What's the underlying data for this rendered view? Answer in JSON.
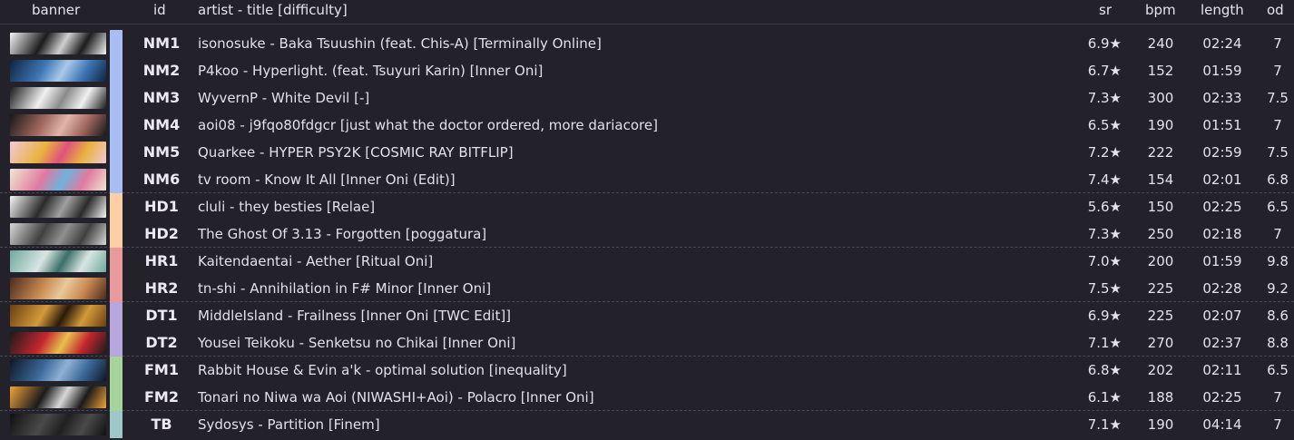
{
  "headers": {
    "banner": "banner",
    "id": "id",
    "title": "artist - title [difficulty]",
    "sr": "sr",
    "bpm": "bpm",
    "length": "length",
    "od": "od"
  },
  "mod_colors": {
    "NM": "#a7bdf4",
    "HD": "#f9cfa3",
    "HR": "#e89a9a",
    "DT": "#b7a6dc",
    "FM": "#a6d39a",
    "TB": "#9ec6c9"
  },
  "rows": [
    {
      "id": "NM1",
      "mod": "NM",
      "title": "isonosuke - Baka Tsuushin (feat. Chis-A) [Terminally Online]",
      "sr": "6.9★",
      "bpm": "240",
      "length": "02:24",
      "od": "7",
      "banner_colors": [
        "#f5f5f5",
        "#1c1c1c",
        "#cfcfcf"
      ]
    },
    {
      "id": "NM2",
      "mod": "NM",
      "title": "P4koo - Hyperlight. (feat. Tsuyuri Karin) [Inner Oni]",
      "sr": "6.7★",
      "bpm": "152",
      "length": "01:59",
      "od": "7",
      "banner_colors": [
        "#0e2440",
        "#3f77b5",
        "#a9c9ea"
      ]
    },
    {
      "id": "NM3",
      "mod": "NM",
      "title": "WyvernP - White Devil [-]",
      "sr": "7.3★",
      "bpm": "300",
      "length": "02:33",
      "od": "7.5",
      "banner_colors": [
        "#1a1a1a",
        "#f0f0f0",
        "#8a8a8a"
      ]
    },
    {
      "id": "NM4",
      "mod": "NM",
      "title": "aoi08 - j9fqo80fdgcr [just what the doctor ordered, more dariacore]",
      "sr": "6.5★",
      "bpm": "190",
      "length": "01:51",
      "od": "7",
      "banner_colors": [
        "#171717",
        "#a36a60",
        "#e1b5a8"
      ]
    },
    {
      "id": "NM5",
      "mod": "NM",
      "title": "Quarkee - HYPER PSY2K [COSMIC RAY BITFLIP]",
      "sr": "7.2★",
      "bpm": "222",
      "length": "02:59",
      "od": "7.5",
      "banner_colors": [
        "#f3c8d6",
        "#e9b23f",
        "#e0527c"
      ]
    },
    {
      "id": "NM6",
      "mod": "NM",
      "title": "tv room - Know It All [Inner Oni (Edit)]",
      "sr": "7.4★",
      "bpm": "154",
      "length": "02:01",
      "od": "6.8",
      "banner_colors": [
        "#f0e7d2",
        "#e07aa0",
        "#6fb2dc"
      ]
    },
    {
      "id": "HD1",
      "mod": "HD",
      "title": "cluli - they besties [Relae]",
      "sr": "5.6★",
      "bpm": "150",
      "length": "02:25",
      "od": "6.5",
      "banner_colors": [
        "#f6f6f6",
        "#2b2b2b",
        "#a0a0a0"
      ]
    },
    {
      "id": "HD2",
      "mod": "HD",
      "title": "The Ghost Of 3.13 - Forgotten [poggatura]",
      "sr": "7.3★",
      "bpm": "250",
      "length": "02:18",
      "od": "7",
      "banner_colors": [
        "#d8d8d8",
        "#404040",
        "#909090"
      ]
    },
    {
      "id": "HR1",
      "mod": "HR",
      "title": "Kaitendaentai - Aether [Ritual Oni]",
      "sr": "7.0★",
      "bpm": "200",
      "length": "01:59",
      "od": "9.8",
      "banner_colors": [
        "#6fa89d",
        "#d9e6e3",
        "#3a6f68"
      ]
    },
    {
      "id": "HR2",
      "mod": "HR",
      "title": "tn-shi - Annihilation in F# Minor [Inner Oni]",
      "sr": "7.5★",
      "bpm": "225",
      "length": "02:28",
      "od": "9.2",
      "banner_colors": [
        "#4a2a1c",
        "#c98a52",
        "#e9c89a"
      ]
    },
    {
      "id": "DT1",
      "mod": "DT",
      "title": "MiddleIsland - Frailness [Inner Oni [TWC Edit]]",
      "sr": "6.9★",
      "bpm": "225",
      "length": "02:07",
      "od": "8.6",
      "banner_colors": [
        "#6a3f12",
        "#d39a3a",
        "#2a1a08"
      ]
    },
    {
      "id": "DT2",
      "mod": "DT",
      "title": "Yousei Teikoku - Senketsu no Chikai [Inner Oni]",
      "sr": "7.1★",
      "bpm": "270",
      "length": "02:37",
      "od": "8.8",
      "banner_colors": [
        "#1b1b1b",
        "#c4262e",
        "#e6c04d"
      ]
    },
    {
      "id": "FM1",
      "mod": "FM",
      "title": "Rabbit House & Evin a'k - optimal solution [inequality]",
      "sr": "6.8★",
      "bpm": "202",
      "length": "02:11",
      "od": "6.5",
      "banner_colors": [
        "#0d1726",
        "#3d6a9a",
        "#8fb1d6"
      ]
    },
    {
      "id": "FM2",
      "mod": "FM",
      "title": "Tonari no Niwa wa Aoi (NIWASHI+Aoi) - Polacro [Inner Oni]",
      "sr": "6.1★",
      "bpm": "188",
      "length": "02:25",
      "od": "7",
      "banner_colors": [
        "#f2a33a",
        "#1a1a1a",
        "#d8d8d8"
      ]
    },
    {
      "id": "TB",
      "mod": "TB",
      "title": "Sydosys - Partition [Finem]",
      "sr": "7.1★",
      "bpm": "190",
      "length": "04:14",
      "od": "7",
      "banner_colors": [
        "#101010",
        "#4a4a4a",
        "#202020"
      ]
    }
  ]
}
